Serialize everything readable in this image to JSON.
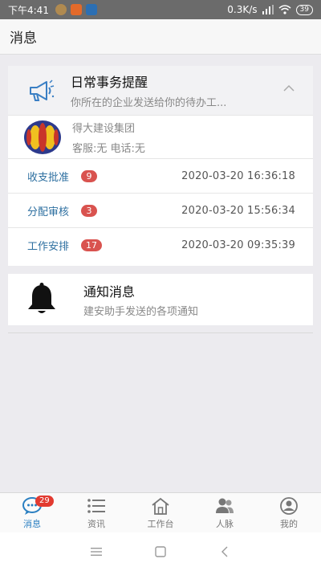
{
  "status_bar": {
    "time": "下午4:41",
    "net_speed": "0.3K/s",
    "battery": "39"
  },
  "header": {
    "title": "消息"
  },
  "reminder_card": {
    "title": "日常事务提醒",
    "subtitle": "你所在的企业发送给你的待办工...",
    "company": {
      "name": "得大建设集团",
      "contact": "客服:无 电话:无"
    },
    "rows": [
      {
        "label": "收支批准",
        "count": "9",
        "date": "2020-03-20 16:36:18"
      },
      {
        "label": "分配审核",
        "count": "3",
        "date": "2020-03-20 15:56:34"
      },
      {
        "label": "工作安排",
        "count": "17",
        "date": "2020-03-20 09:35:39"
      }
    ]
  },
  "notice_card": {
    "title": "通知消息",
    "subtitle": "建安助手发送的各项通知"
  },
  "tabbar": {
    "items": [
      {
        "label": "消息",
        "icon": "chat-bubble-icon",
        "badge": "29"
      },
      {
        "label": "资讯",
        "icon": "list-icon"
      },
      {
        "label": "工作台",
        "icon": "home-icon"
      },
      {
        "label": "人脉",
        "icon": "people-icon"
      },
      {
        "label": "我的",
        "icon": "user-icon"
      }
    ]
  },
  "colors": {
    "accent": "#2a7fc1",
    "link": "#2d6fa0",
    "badge": "#d9534f"
  }
}
